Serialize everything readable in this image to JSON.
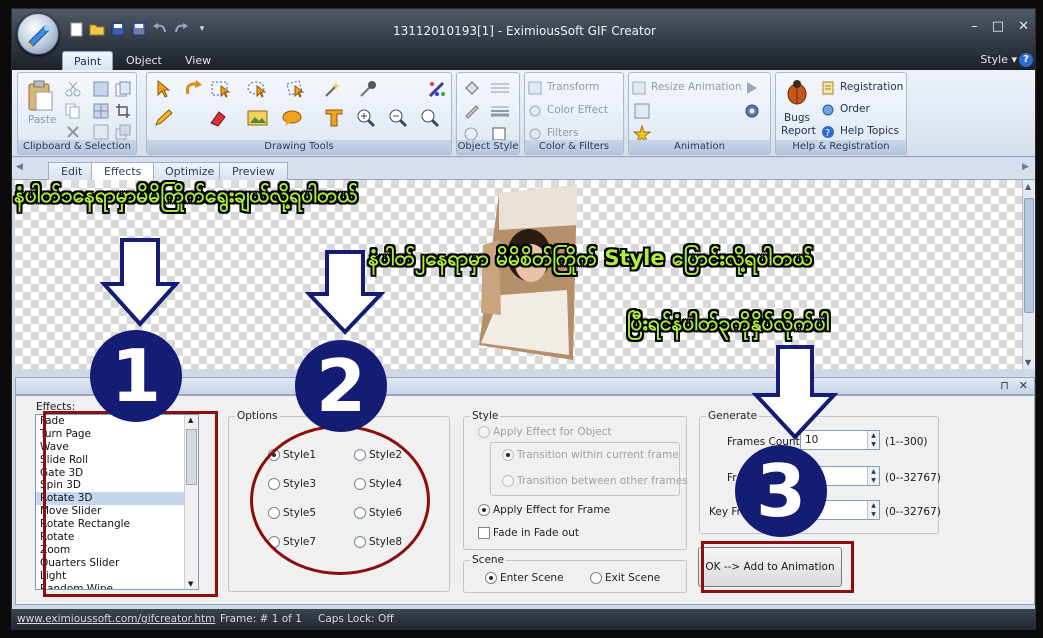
{
  "window": {
    "title": "13112010193[1] - EximiousSoft GIF Creator"
  },
  "ribbon_tabs": [
    "Paint",
    "Object",
    "View"
  ],
  "style_menu": "Style",
  "ribbon": {
    "clipboard": {
      "label": "Clipboard & Selection",
      "paste": "Paste"
    },
    "drawing": {
      "label": "Drawing Tools"
    },
    "objstyle": {
      "label": "Object Style"
    },
    "colorfilters": {
      "label": "Color & Filters",
      "transform": "Transform",
      "color_effect": "Color Effect",
      "filters": "Filters"
    },
    "animation": {
      "label": "Animation",
      "resize": "Resize Animation"
    },
    "help": {
      "label": "Help & Registration",
      "bugs1": "Bugs",
      "bugs2": "Report",
      "registration": "Registration",
      "order": "Order",
      "help_topics": "Help Topics"
    }
  },
  "doc_tabs": [
    "Edit",
    "Effects",
    "Optimize",
    "Preview"
  ],
  "annotations": {
    "line1": "နံပါတ်၁နေရာမှာမိမိကြိုက်ရွေးချယ်လို့ရပါတယ်",
    "line2": "နံပါတ်၂နေရာမှာ မိမိစိတ်ကြိုက် Style ပြောင်းလို့ရပါတယ်",
    "line3": "ပြီးရင်နံပါတ်၃ကိုနှိပ်လိုက်ပါ"
  },
  "markers": [
    "1",
    "2",
    "3"
  ],
  "effects": {
    "label": "Effects:",
    "items": [
      "Fade",
      "Turn Page",
      "Wave",
      "Slide Roll",
      "Gate 3D",
      "Spin 3D",
      "Rotate 3D",
      "Move Slider",
      "Rotate Rectangle",
      "Rotate",
      "Zoom",
      "Quarters Slider",
      "Light",
      "Random Wipe"
    ],
    "selected": "Rotate 3D"
  },
  "options": {
    "label": "Options",
    "styles": [
      "Style1",
      "Style2",
      "Style3",
      "Style4",
      "Style5",
      "Style6",
      "Style7",
      "Style8"
    ],
    "selected": "Style1"
  },
  "style_group": {
    "label": "Style",
    "apply_object": "Apply Effect for Object",
    "within_frame": "Transition within current frame",
    "between_frames": "Transition between other frames",
    "apply_frame": "Apply Effect  for Frame",
    "fade": "Fade in Fade out"
  },
  "scene": {
    "label": "Scene",
    "enter": "Enter Scene",
    "exit": "Exit Scene"
  },
  "generate": {
    "label": "Generate",
    "frames_count_label": "Frames Count:",
    "frames_count": "10",
    "frames_range": "(1--300)",
    "f2_label": "Fr",
    "range2": "(0--32767)",
    "key_label": "Key Fr",
    "range3": "(0--32767)"
  },
  "ok_button": "OK --> Add to Animation",
  "status": {
    "url": "www.eximioussoft.com/gifcreator.htm",
    "frame": "Frame: # 1 of 1",
    "caps": "Caps Lock: Off"
  },
  "colors": {
    "accent_red": "#8b0d0d",
    "marker_blue": "#141c73",
    "annotation_green": "#aef03a"
  }
}
